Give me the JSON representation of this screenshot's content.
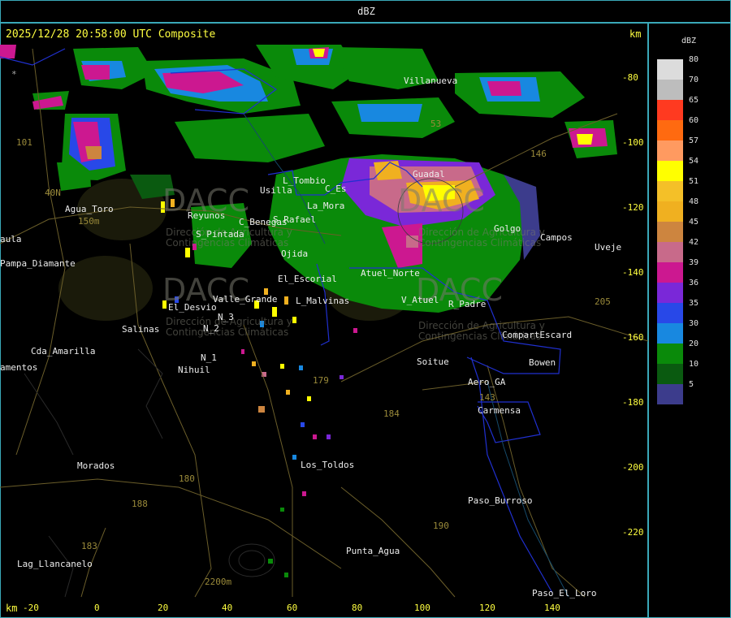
{
  "title": "dBZ",
  "timestamp": "2025/12/28 20:58:00 UTC Composite",
  "axis_unit": "km",
  "y_ticks": [
    "-80",
    "-100",
    "-120",
    "-140",
    "-160",
    "-180",
    "-200",
    "-220"
  ],
  "x_ticks": [
    "-20",
    "0",
    "20",
    "40",
    "60",
    "80",
    "100",
    "120",
    "140"
  ],
  "legend": {
    "title": "dBZ",
    "levels": [
      {
        "label": "80",
        "color": "#dcdcdc"
      },
      {
        "label": "70",
        "color": "#bdbdbd"
      },
      {
        "label": "65",
        "color": "#ff3a20"
      },
      {
        "label": "60",
        "color": "#ff6a10"
      },
      {
        "label": "57",
        "color": "#ff9a60"
      },
      {
        "label": "54",
        "color": "#ffff00"
      },
      {
        "label": "51",
        "color": "#f4c028"
      },
      {
        "label": "48",
        "color": "#f0b020"
      },
      {
        "label": "45",
        "color": "#cd853f"
      },
      {
        "label": "42",
        "color": "#c86a8a"
      },
      {
        "label": "39",
        "color": "#cc1890"
      },
      {
        "label": "36",
        "color": "#7a28d8"
      },
      {
        "label": "35",
        "color": "#2848e8"
      },
      {
        "label": "30",
        "color": "#1888e0"
      },
      {
        "label": "20",
        "color": "#0a8a0a"
      },
      {
        "label": "10",
        "color": "#0a5a10"
      },
      {
        "label": "5",
        "color": "#3c3c8c"
      }
    ]
  },
  "places": [
    "Villanueva",
    "Guadal",
    "Golgo",
    "Campos",
    "Uveje",
    "Agua_Toro",
    "Pampa_Diamante",
    "Usilla",
    "L_Tombio",
    "C_Es",
    "La_Mora",
    "Reyunos",
    "S_Pintada",
    "C_Benegas",
    "S_Rafael",
    "Ojida",
    "El_Escorial",
    "L_Malvinas",
    "Atuel_Norte",
    "V_Atuel",
    "R_Padre",
    "El_Desvio",
    "Valle_Grande",
    "N_3",
    "N_2",
    "N_1",
    "Salinas",
    "Cda_Amarilla",
    "Nihuil",
    "Soitue",
    "CompartEscard",
    "Bowen",
    "Aero_GA",
    "Carmensa",
    "Los_Toldos",
    "Morados",
    "Paso_Burroso",
    "Punta_Agua",
    "Lag_Llancanelo",
    "Paso_El_Loro",
    "amentos",
    "aula"
  ],
  "routes": [
    "101",
    "40N",
    "146",
    "205",
    "143",
    "179",
    "184",
    "180",
    "188",
    "190",
    "183",
    "150m",
    "2200m",
    "53"
  ],
  "watermark": {
    "brand": "DACC",
    "subtitle": "Dirección de Agricultura y Contingencias Climáticas"
  },
  "icons": {
    "marker": "asterisk-icon"
  }
}
